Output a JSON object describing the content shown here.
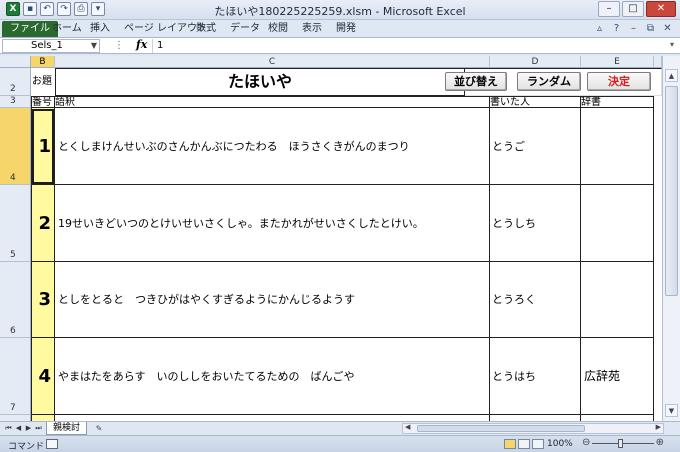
{
  "window": {
    "title": "たほいや180225225259.xlsm - Microsoft Excel"
  },
  "ribbon": {
    "tabs": [
      "ファイル",
      "ホーム",
      "挿入",
      "ページ レイアウト",
      "数式",
      "データ",
      "校閲",
      "表示",
      "開発"
    ]
  },
  "formula_bar": {
    "name_box": "Sels_1",
    "fx_label": "fx",
    "value": "1"
  },
  "columns": [
    "B",
    "C",
    "D",
    "E"
  ],
  "rows": [
    "2",
    "3",
    "4",
    "5",
    "6",
    "7"
  ],
  "sheet": {
    "odai_label": "お題",
    "title": "たほいや",
    "buttons": {
      "sort": "並び替え",
      "random": "ランダム",
      "decide": "決定"
    },
    "headers": {
      "number": "番号",
      "definition": "語釈",
      "author": "書いた人",
      "dictionary": "辞書"
    },
    "entries": [
      {
        "number": "1",
        "definition": "とくしまけんせいぶのさんかんぶにつたわる　ほうさくきがんのまつり",
        "author": "とうご",
        "dictionary": ""
      },
      {
        "number": "2",
        "definition": "19せいきどいつのとけいせいさくしゃ。またかれがせいさくしたとけい。",
        "author": "とうしち",
        "dictionary": ""
      },
      {
        "number": "3",
        "definition": "としをとると　つきひがはやくすぎるようにかんじるようす",
        "author": "とうろく",
        "dictionary": ""
      },
      {
        "number": "4",
        "definition": "やまはたをあらす　いのししをおいたてるための　ばんごや",
        "author": "とうはち",
        "dictionary": "広辞苑"
      }
    ]
  },
  "sheet_tabs": [
    "親検討"
  ],
  "status": {
    "mode": "コマンド",
    "zoom": "100%"
  }
}
